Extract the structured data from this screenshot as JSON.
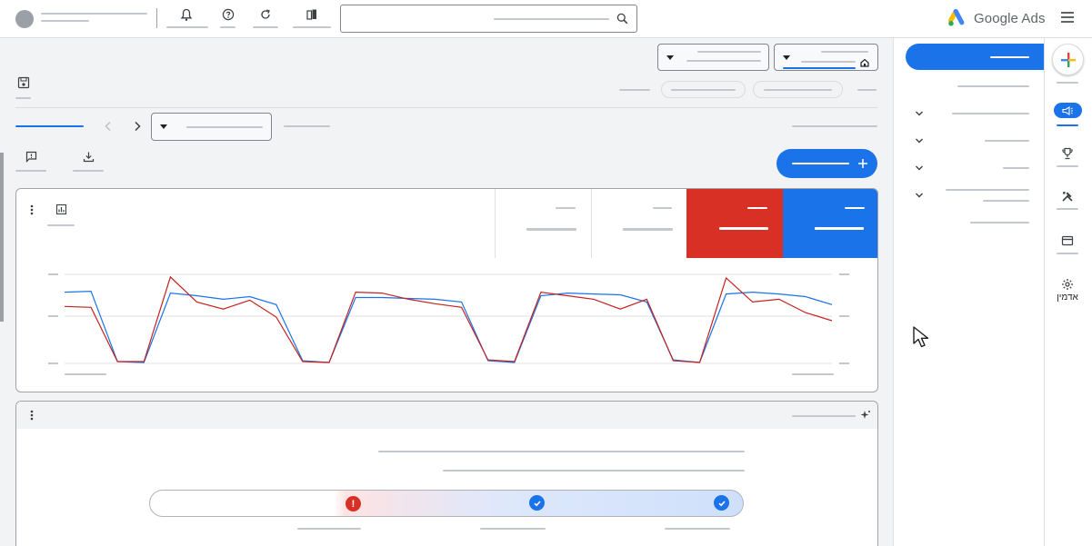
{
  "app": {
    "brand": "Google Ads"
  },
  "nav": {
    "admin_label": "אדמין"
  },
  "icons": {
    "notifications": "bell-icon",
    "help": "help-icon",
    "refresh": "refresh-icon",
    "appearance": "panels-icon",
    "search": "search-icon",
    "menu": "hamburger-icon",
    "create": "plus-icon",
    "campaigns": "megaphone-icon",
    "goals": "trophy-icon",
    "tools": "tools-icon",
    "billing": "card-icon",
    "admin": "gear-icon",
    "save": "save-icon",
    "feedback": "feedback-icon",
    "download": "download-icon",
    "card_menu": "more-vert-icon",
    "chart_settings": "chart-icon",
    "insights": "sparkle-icon",
    "warning": "error-icon",
    "done": "check-icon"
  },
  "colors": {
    "primary_blue": "#1a73e8",
    "alert_red": "#d93025",
    "series_blue": "#1a73e8",
    "series_red": "#c5221f"
  },
  "chart_data": {
    "type": "line",
    "series": [
      {
        "values": [
          0.8,
          0.81,
          0.02,
          0.01,
          0.79,
          0.76,
          0.72,
          0.75,
          0.66,
          0.03,
          0.01,
          0.74,
          0.74,
          0.73,
          0.72,
          0.69,
          0.03,
          0.01,
          0.76,
          0.79,
          0.78,
          0.77,
          0.69,
          0.04,
          0.01,
          0.78,
          0.8,
          0.78,
          0.75,
          0.66
        ]
      },
      {
        "values": [
          0.64,
          0.63,
          0.02,
          0.02,
          0.97,
          0.69,
          0.61,
          0.71,
          0.52,
          0.02,
          0.01,
          0.8,
          0.79,
          0.72,
          0.67,
          0.63,
          0.04,
          0.02,
          0.8,
          0.76,
          0.72,
          0.61,
          0.72,
          0.03,
          0.01,
          0.96,
          0.69,
          0.72,
          0.57,
          0.48
        ]
      }
    ]
  }
}
